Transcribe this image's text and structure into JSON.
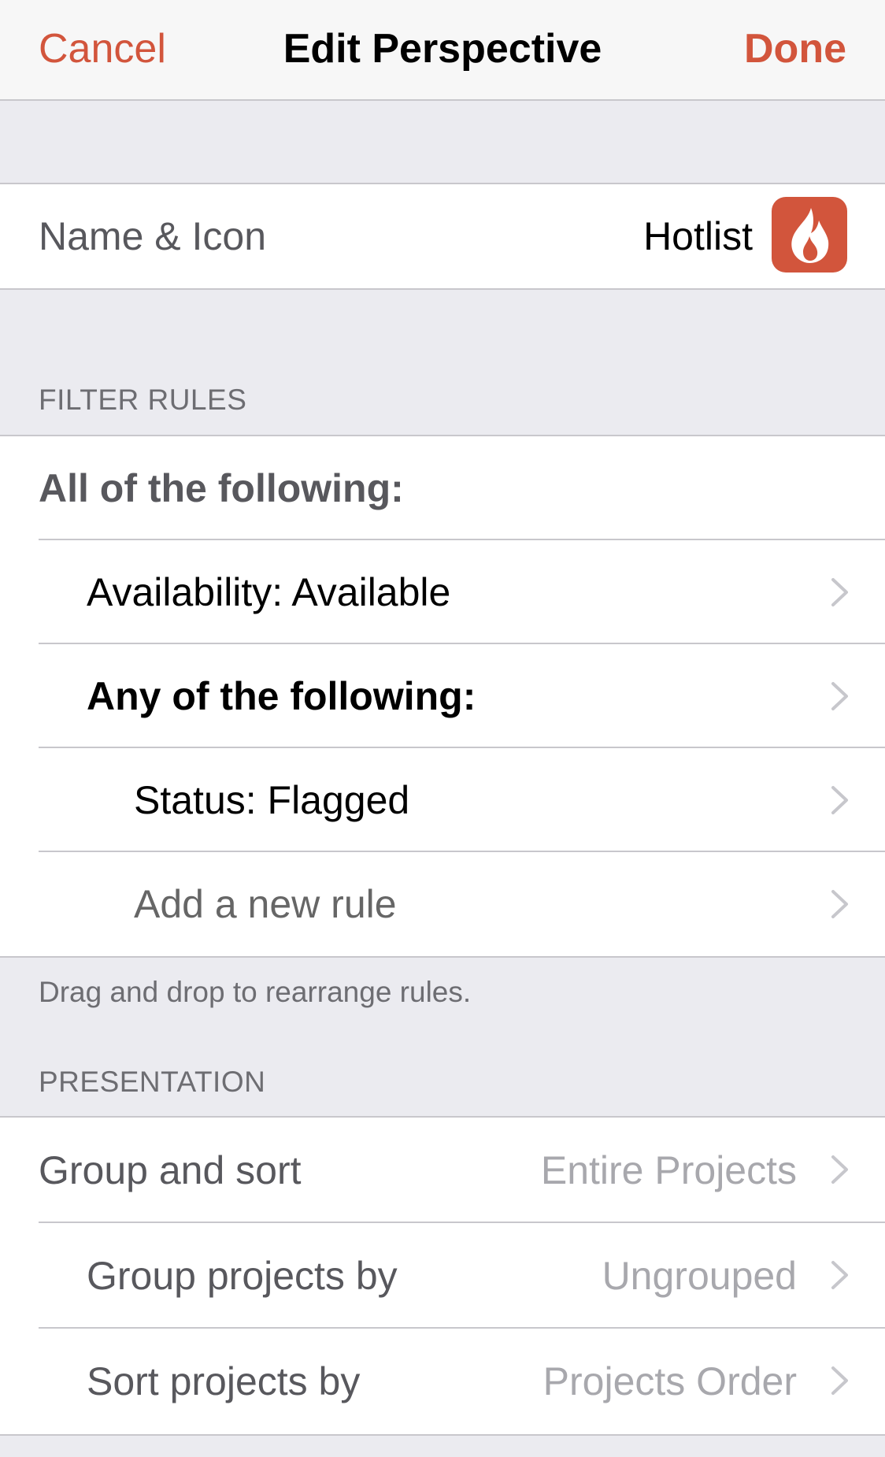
{
  "navbar": {
    "cancel": "Cancel",
    "title": "Edit Perspective",
    "done": "Done"
  },
  "name_icon": {
    "label": "Name & Icon",
    "value": "Hotlist",
    "icon": "flame-icon",
    "icon_color": "#d2553c"
  },
  "filter_rules": {
    "header": "FILTER RULES",
    "rows": [
      {
        "label": "All of the following:"
      },
      {
        "label": "Availability: Available"
      },
      {
        "label": "Any of the following:"
      },
      {
        "label": "Status: Flagged"
      },
      {
        "label": "Add a new rule"
      }
    ],
    "footer": "Drag and drop to rearrange rules."
  },
  "presentation": {
    "header": "PRESENTATION",
    "rows": [
      {
        "label": "Group and sort",
        "value": "Entire Projects"
      },
      {
        "label": "Group projects by",
        "value": "Ungrouped"
      },
      {
        "label": "Sort projects by",
        "value": "Projects Order"
      }
    ]
  },
  "colors": {
    "accent": "#d2553c",
    "background": "#ebebf0",
    "separator": "#c8c7cc"
  }
}
